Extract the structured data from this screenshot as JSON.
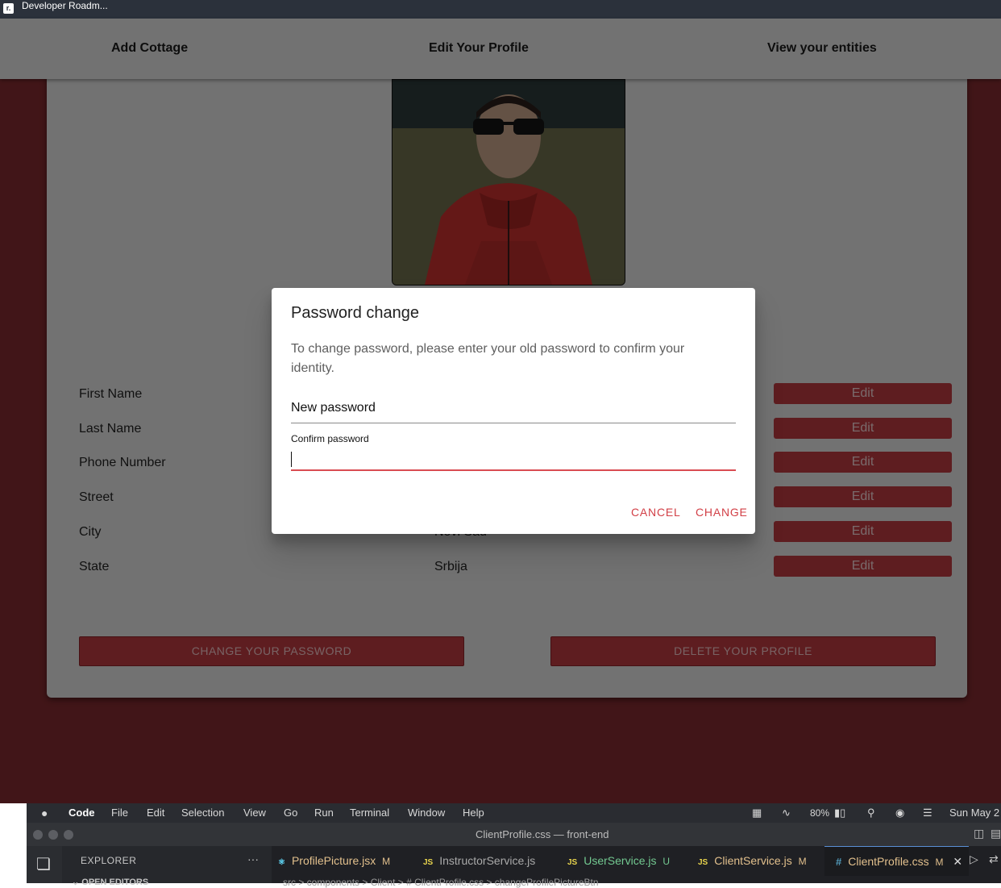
{
  "browser": {
    "favicon": "r.",
    "title": "Developer Roadm..."
  },
  "nav": {
    "items": [
      {
        "label": "Add Cottage"
      },
      {
        "label": "Edit Your Profile"
      },
      {
        "label": "View your entities"
      }
    ]
  },
  "profile": {
    "rows": [
      {
        "label": "First Name",
        "value": "",
        "edit": "Edit"
      },
      {
        "label": "Last Name",
        "value": "",
        "edit": "Edit"
      },
      {
        "label": "Phone Number",
        "value": "",
        "edit": "Edit"
      },
      {
        "label": "Street",
        "value": "",
        "edit": "Edit"
      },
      {
        "label": "City",
        "value": "Novi Sad",
        "edit": "Edit"
      },
      {
        "label": "State",
        "value": "Srbija",
        "edit": "Edit"
      }
    ],
    "change_password_label": "CHANGE YOUR PASSWORD",
    "delete_profile_label": "DELETE YOUR PROFILE"
  },
  "dialog": {
    "title": "Password change",
    "description": "To change password, please enter your old password to confirm your identity.",
    "new_password_placeholder": "New password",
    "confirm_label": "Confirm password",
    "confirm_value": "",
    "cancel_label": "CANCEL",
    "change_label": "CHANGE"
  },
  "menubar": {
    "app": "Code",
    "items": [
      "File",
      "Edit",
      "Selection",
      "View",
      "Go",
      "Run",
      "Terminal",
      "Window",
      "Help"
    ],
    "battery": "80%",
    "clock": "Sun May 2"
  },
  "vscode": {
    "window_title": "ClientProfile.css — front-end",
    "explorer_label": "EXPLORER",
    "explorer_more": "···",
    "open_editors": "OPEN EDITORS",
    "tabs": [
      {
        "name": "ProfilePicture.jsx",
        "status": "M",
        "icon": "⚛",
        "color": "#e2c08d"
      },
      {
        "name": "InstructorService.js",
        "status": "",
        "icon": "JS",
        "color": "#a9a9a9"
      },
      {
        "name": "UserService.js",
        "status": "U",
        "icon": "JS",
        "color": "#73c991"
      },
      {
        "name": "ClientService.js",
        "status": "M",
        "icon": "JS",
        "color": "#e2c08d"
      },
      {
        "name": "ClientProfile.css",
        "status": "M",
        "icon": "#",
        "color": "#e2c08d"
      }
    ],
    "breadcrumb": "src > components > Client > # ClientProfile.css > changeProfilePictureBtn"
  }
}
